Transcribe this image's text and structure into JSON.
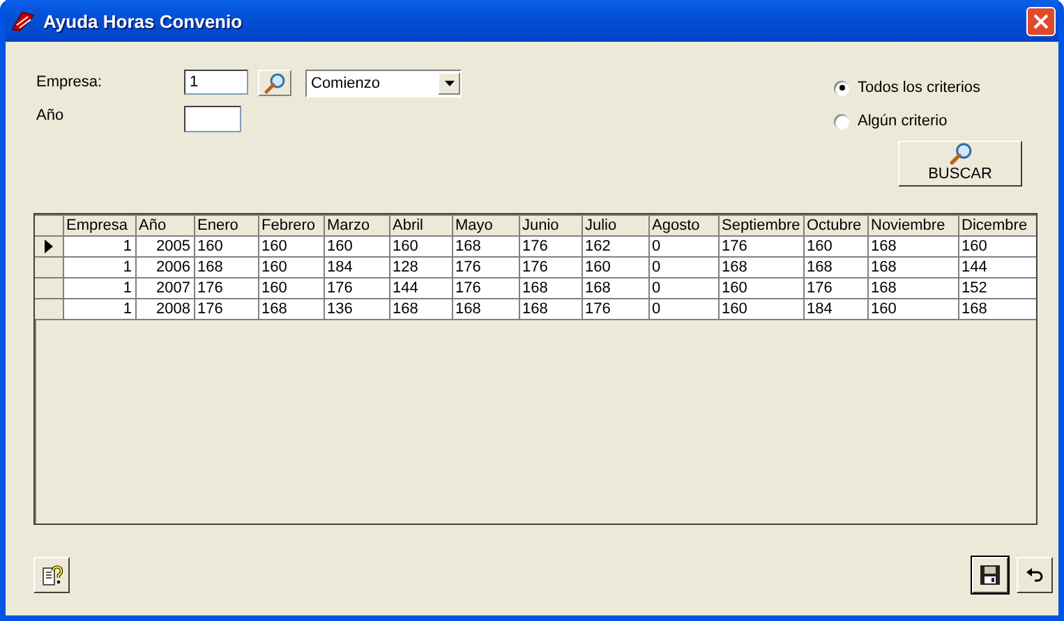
{
  "window": {
    "title": "Ayuda Horas Convenio"
  },
  "form": {
    "empresa_label": "Empresa:",
    "empresa_value": "1",
    "match_mode": "Comienzo",
    "year_label": "Año"
  },
  "criteria": [
    {
      "label": "Todos los criterios",
      "selected": true
    },
    {
      "label": "Algún criterio",
      "selected": false
    }
  ],
  "search_button": "BUSCAR",
  "table": {
    "columns": [
      "Empresa",
      "Año",
      "Enero",
      "Febrero",
      "Marzo",
      "Abril",
      "Mayo",
      "Junio",
      "Julio",
      "Agosto",
      "Septiembre",
      "Octubre",
      "Noviembre",
      "Dicembre"
    ],
    "rows": [
      {
        "selected": true,
        "cells": [
          "1",
          "2005",
          "160",
          "160",
          "160",
          "160",
          "168",
          "176",
          "162",
          "0",
          "176",
          "160",
          "168",
          "160"
        ]
      },
      {
        "selected": false,
        "cells": [
          "1",
          "2006",
          "168",
          "160",
          "184",
          "128",
          "176",
          "176",
          "160",
          "0",
          "168",
          "168",
          "168",
          "144"
        ]
      },
      {
        "selected": false,
        "cells": [
          "1",
          "2007",
          "176",
          "160",
          "176",
          "144",
          "176",
          "168",
          "168",
          "0",
          "160",
          "176",
          "168",
          "152"
        ]
      },
      {
        "selected": false,
        "cells": [
          "1",
          "2008",
          "176",
          "168",
          "136",
          "168",
          "168",
          "168",
          "176",
          "0",
          "160",
          "184",
          "160",
          "168"
        ]
      }
    ]
  }
}
